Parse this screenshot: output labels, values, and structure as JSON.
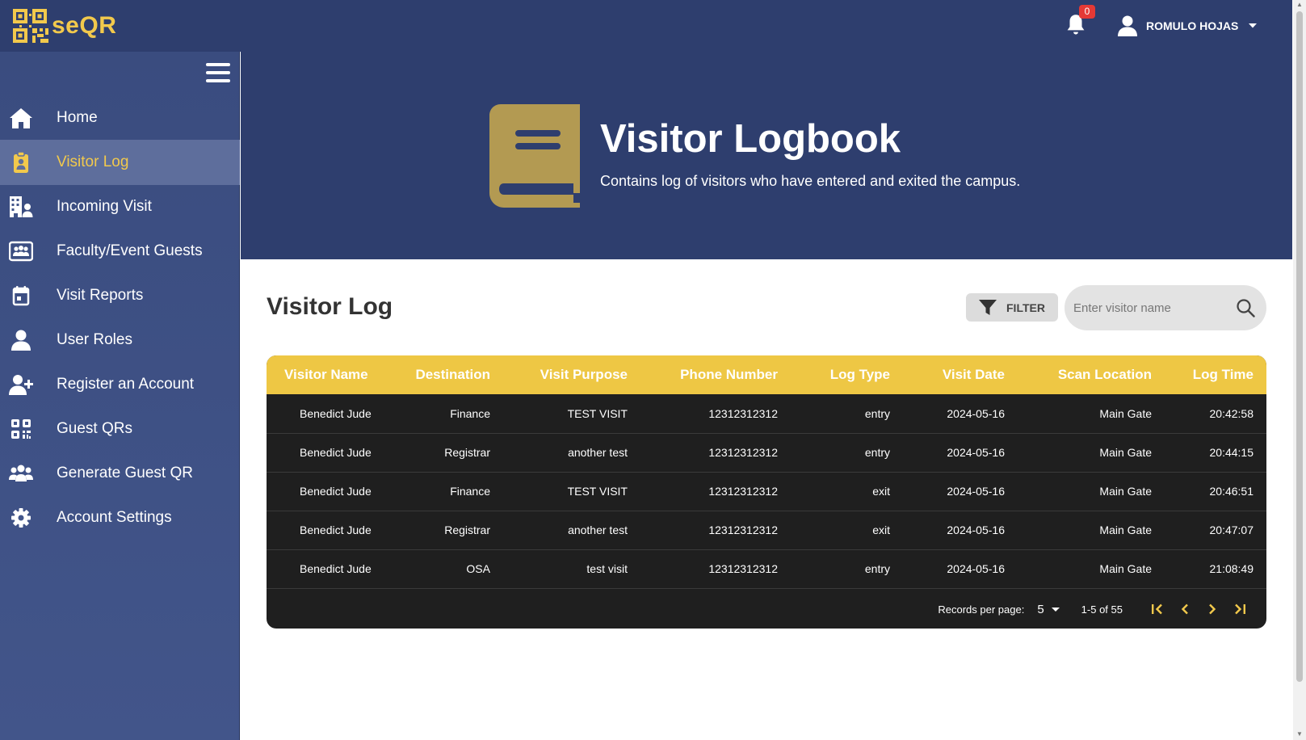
{
  "app": {
    "logo_text": "seQR",
    "notification_count": "0",
    "user_name": "ROMULO HOJAS"
  },
  "colors": {
    "nav_bg": "#2e3e6e",
    "accent": "#f2c94c",
    "table_header": "#eec744",
    "table_body": "#1f1f1f",
    "book_icon": "#b39a52"
  },
  "sidebar": {
    "items": [
      {
        "label": "Home",
        "icon": "home-icon"
      },
      {
        "label": "Visitor Log",
        "icon": "clipboard-user-icon",
        "active": true
      },
      {
        "label": "Incoming Visit",
        "icon": "building-user-icon"
      },
      {
        "label": "Faculty/Event Guests",
        "icon": "guests-card-icon"
      },
      {
        "label": "Visit Reports",
        "icon": "calendar-icon"
      },
      {
        "label": "User Roles",
        "icon": "user-icon"
      },
      {
        "label": "Register an Account",
        "icon": "user-plus-icon"
      },
      {
        "label": "Guest QRs",
        "icon": "qr-code-icon"
      },
      {
        "label": "Generate Guest QR",
        "icon": "users-icon"
      },
      {
        "label": "Account Settings",
        "icon": "gear-icon"
      }
    ]
  },
  "hero": {
    "title": "Visitor Logbook",
    "subtitle": "Contains log of visitors who have entered and exited the campus."
  },
  "main": {
    "title": "Visitor Log",
    "filter_label": "FILTER",
    "search_placeholder": "Enter visitor name"
  },
  "table": {
    "columns": [
      "Visitor Name",
      "Destination",
      "Visit Purpose",
      "Phone Number",
      "Log Type",
      "Visit Date",
      "Scan Location",
      "Log Time"
    ],
    "rows": [
      [
        "Benedict Jude",
        "Finance",
        "TEST VISIT",
        "12312312312",
        "entry",
        "2024-05-16",
        "Main Gate",
        "20:42:58"
      ],
      [
        "Benedict Jude",
        "Registrar",
        "another test",
        "12312312312",
        "entry",
        "2024-05-16",
        "Main Gate",
        "20:44:15"
      ],
      [
        "Benedict Jude",
        "Finance",
        "TEST VISIT",
        "12312312312",
        "exit",
        "2024-05-16",
        "Main Gate",
        "20:46:51"
      ],
      [
        "Benedict Jude",
        "Registrar",
        "another test",
        "12312312312",
        "exit",
        "2024-05-16",
        "Main Gate",
        "20:47:07"
      ],
      [
        "Benedict Jude",
        "OSA",
        "test visit",
        "12312312312",
        "entry",
        "2024-05-16",
        "Main Gate",
        "21:08:49"
      ]
    ]
  },
  "pagination": {
    "records_label": "Records per page:",
    "per_page": "5",
    "range": "1-5 of 55"
  }
}
